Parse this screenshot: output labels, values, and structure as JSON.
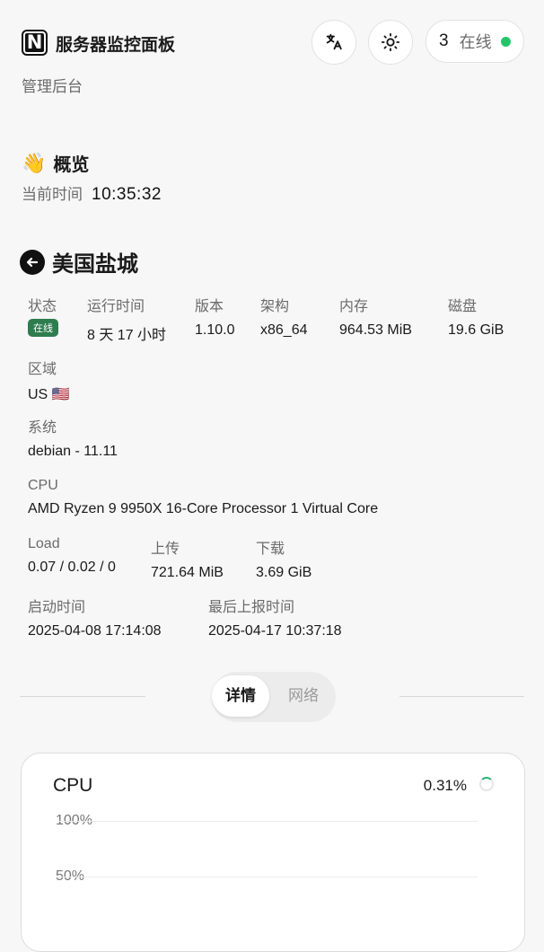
{
  "header": {
    "brand": "服务器监控面板",
    "subtitle": "管理后台",
    "online_count": "3",
    "online_label": "在线"
  },
  "overview": {
    "emoji": "👋",
    "title": "概览",
    "time_label": "当前时间",
    "time_value": "10:35:32"
  },
  "server": {
    "name": "美国盐城",
    "fields": {
      "status": {
        "label": "状态",
        "value": "在线"
      },
      "uptime": {
        "label": "运行时间",
        "value": "8 天 17 小时"
      },
      "version": {
        "label": "版本",
        "value": "1.10.0"
      },
      "arch": {
        "label": "架构",
        "value": "x86_64"
      },
      "memory": {
        "label": "内存",
        "value": "964.53 MiB"
      },
      "disk": {
        "label": "磁盘",
        "value": "19.6 GiB"
      },
      "region": {
        "label": "区域",
        "value": "US 🇺🇸"
      },
      "os": {
        "label": "系统",
        "value": "debian - 11.11"
      },
      "cpu": {
        "label": "CPU",
        "value": "AMD Ryzen 9 9950X 16-Core Processor 1 Virtual Core"
      },
      "load": {
        "label": "Load",
        "value": "0.07 / 0.02 / 0"
      },
      "upload": {
        "label": "上传",
        "value": "721.64 MiB"
      },
      "download": {
        "label": "下载",
        "value": "3.69 GiB"
      },
      "boot_time": {
        "label": "启动时间",
        "value": "2025-04-08 17:14:08"
      },
      "last_report": {
        "label": "最后上报时间",
        "value": "2025-04-17 10:37:18"
      }
    }
  },
  "tabs": [
    {
      "label": "详情",
      "active": true
    },
    {
      "label": "网络",
      "active": false
    }
  ],
  "cpu_card": {
    "title": "CPU",
    "value": "0.31%",
    "y_ticks": [
      "100%",
      "50%"
    ]
  },
  "colors": {
    "online_dot": "#26c46a",
    "status_badge": "#2e7d4f"
  }
}
